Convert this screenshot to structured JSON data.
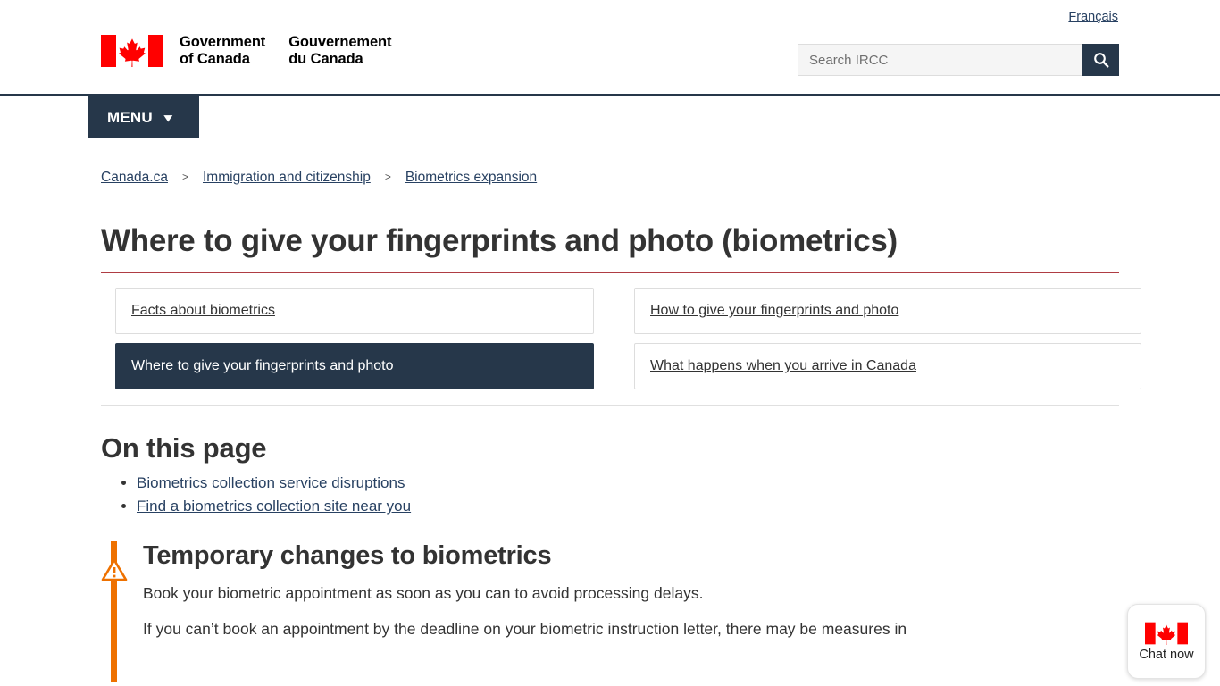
{
  "header": {
    "language_link": "Français",
    "wordmark_en": "Government\nof Canada",
    "wordmark_fr": "Gouvernement\ndu Canada",
    "flag_icon": "canada-flag-icon",
    "search": {
      "placeholder": "Search IRCC",
      "value": "",
      "button_icon": "search-icon"
    },
    "menu": {
      "label": "MENU",
      "chevron_icon": "chevron-down-icon"
    }
  },
  "breadcrumb": {
    "separator": ">",
    "items": [
      {
        "label": "Canada.ca"
      },
      {
        "label": "Immigration and citizenship"
      },
      {
        "label": "Biometrics expansion"
      }
    ]
  },
  "page": {
    "title": "Where to give your fingerprints and photo (biometrics)"
  },
  "tabs": [
    {
      "label": "Facts about biometrics",
      "active": false,
      "column": "left"
    },
    {
      "label": "How to give your fingerprints and photo",
      "active": false,
      "column": "right"
    },
    {
      "label": "Where to give your fingerprints and photo",
      "active": true,
      "column": "left"
    },
    {
      "label": "What happens when you arrive in Canada",
      "active": false,
      "column": "right"
    }
  ],
  "on_this_page": {
    "heading": "On this page",
    "links": [
      {
        "label": "Biometrics collection service disruptions"
      },
      {
        "label": "Find a biometrics collection site near you"
      }
    ]
  },
  "alert": {
    "icon": "warning-triangle-icon",
    "title": "Temporary changes to biometrics",
    "paragraphs": [
      "Book your biometric appointment as soon as you can to avoid processing delays.",
      "If you can’t book an appointment by the deadline on your biometric instruction letter, there may be measures in"
    ]
  },
  "chat": {
    "label": "Chat now",
    "flag_icon": "canada-flag-icon"
  },
  "colors": {
    "nav_dark": "#26374a",
    "link_blue": "#284162",
    "title_rule_red": "#af3c43",
    "alert_orange": "#ee7100",
    "flag_red": "#ff0000"
  }
}
